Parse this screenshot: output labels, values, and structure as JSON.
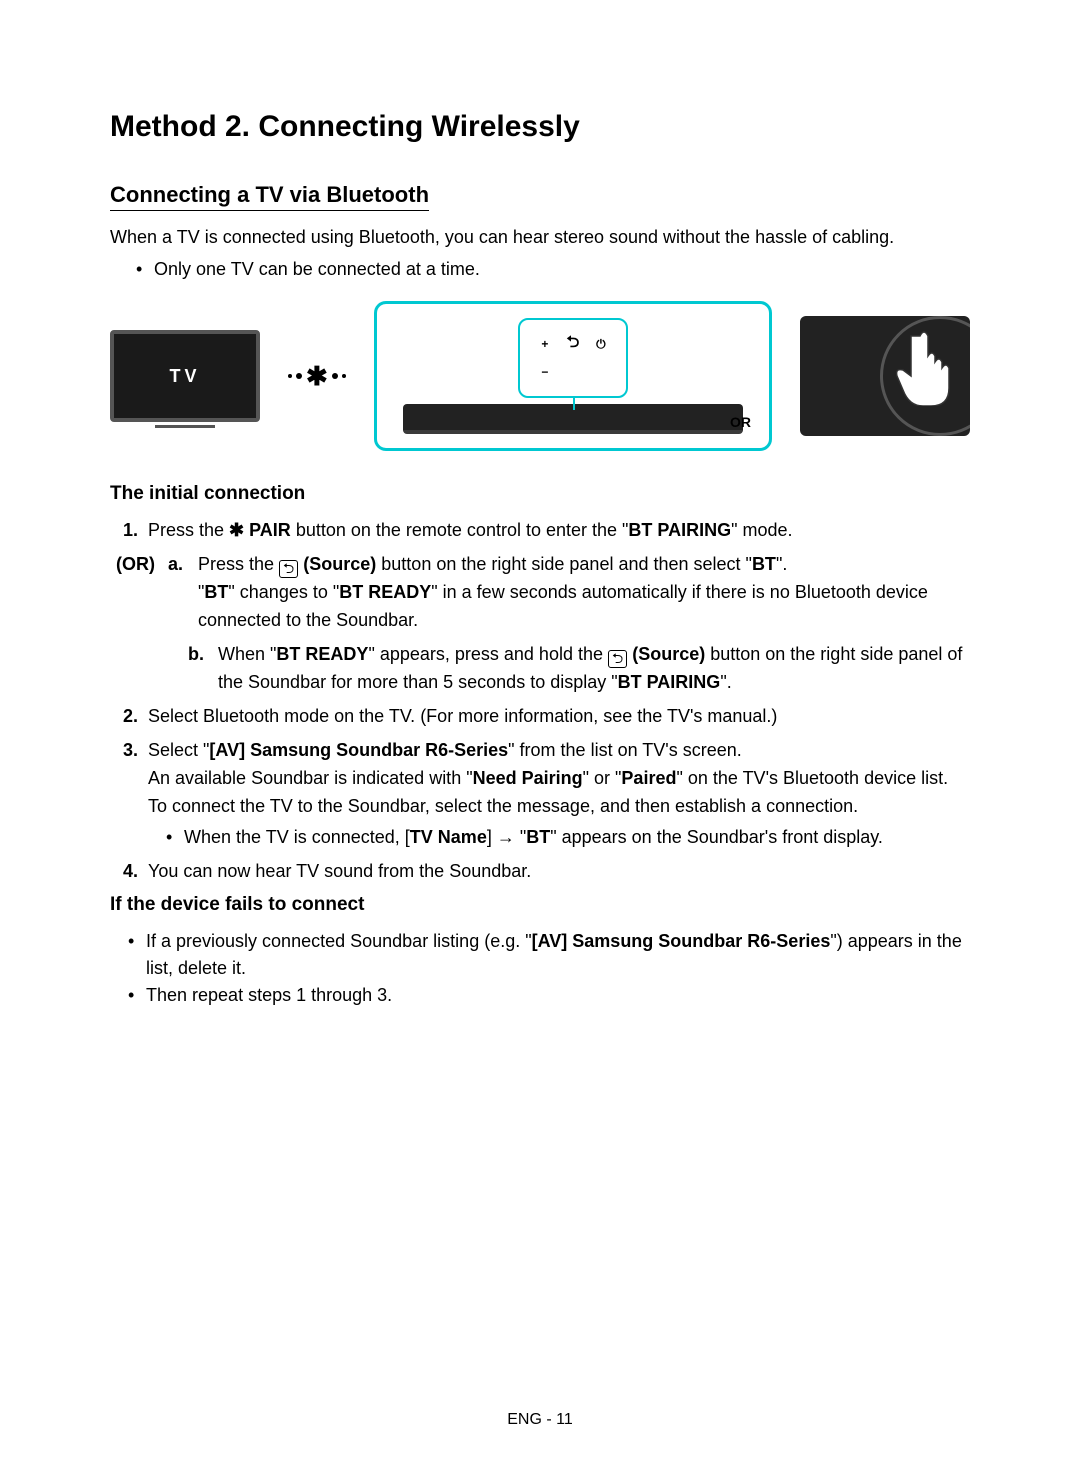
{
  "title": "Method 2. Connecting Wirelessly",
  "section1": {
    "heading": "Connecting a TV via Bluetooth",
    "intro": "When a TV is connected using Bluetooth, you can hear stereo sound without the hassle of cabling.",
    "bullet1": "Only one TV can be connected at a time."
  },
  "diagram": {
    "tv_label": "TV",
    "or_label": "OR",
    "remote": {
      "plus": "+",
      "minus": "−",
      "source": "⮌",
      "power": "⏻"
    }
  },
  "initial": {
    "heading": "The initial connection",
    "step1_pre": "Press the ",
    "step1_pair": " PAIR",
    "step1_post": " button on the remote control to enter the \"",
    "step1_mode": "BT PAIRING",
    "step1_end": "\" mode.",
    "or": "(OR)",
    "a_pre": "Press the ",
    "a_source": " (Source)",
    "a_post": " button on the right side panel and then select \"",
    "a_bt": "BT",
    "a_end": "\".",
    "a_line2_q1": "\"",
    "a_line2_bt": "BT",
    "a_line2_mid": "\" changes to \"",
    "a_line2_ready": "BT READY",
    "a_line2_post": "\" in a few seconds automatically if there is no Bluetooth device connected to the Soundbar.",
    "b_pre": "When \"",
    "b_ready": "BT READY",
    "b_mid": "\" appears, press and hold the ",
    "b_source": " (Source)",
    "b_post": " button on the right side panel of the Soundbar for more than 5 seconds to display \"",
    "b_pairing": "BT PAIRING",
    "b_end": "\".",
    "step2": "Select Bluetooth mode on the TV. (For more information, see the TV's manual.)",
    "step3_pre": "Select \"",
    "step3_device": "[AV] Samsung Soundbar R6-Series",
    "step3_post": "\" from the list on TV's screen.",
    "step3_line2_pre": "An available Soundbar is indicated with \"",
    "step3_need": "Need Pairing",
    "step3_or": "\" or \"",
    "step3_paired": "Paired",
    "step3_line2_post": "\" on the TV's Bluetooth device list. To connect the TV to the Soundbar, select the message, and then establish a connection.",
    "step3_sub_pre": "When the TV is connected, [",
    "step3_sub_tvname": "TV Name",
    "step3_sub_arrow": "] → \"",
    "step3_sub_bt": "BT",
    "step3_sub_post": "\" appears on the Soundbar's front display.",
    "step4": "You can now hear TV sound from the Soundbar."
  },
  "fail": {
    "heading": "If the device fails to connect",
    "b1_pre": "If a previously connected Soundbar listing (e.g. \"",
    "b1_device": "[AV] Samsung Soundbar R6-Series",
    "b1_post": "\") appears in the list, delete it.",
    "b2": "Then repeat steps 1 through 3."
  },
  "footer": "ENG - 11"
}
